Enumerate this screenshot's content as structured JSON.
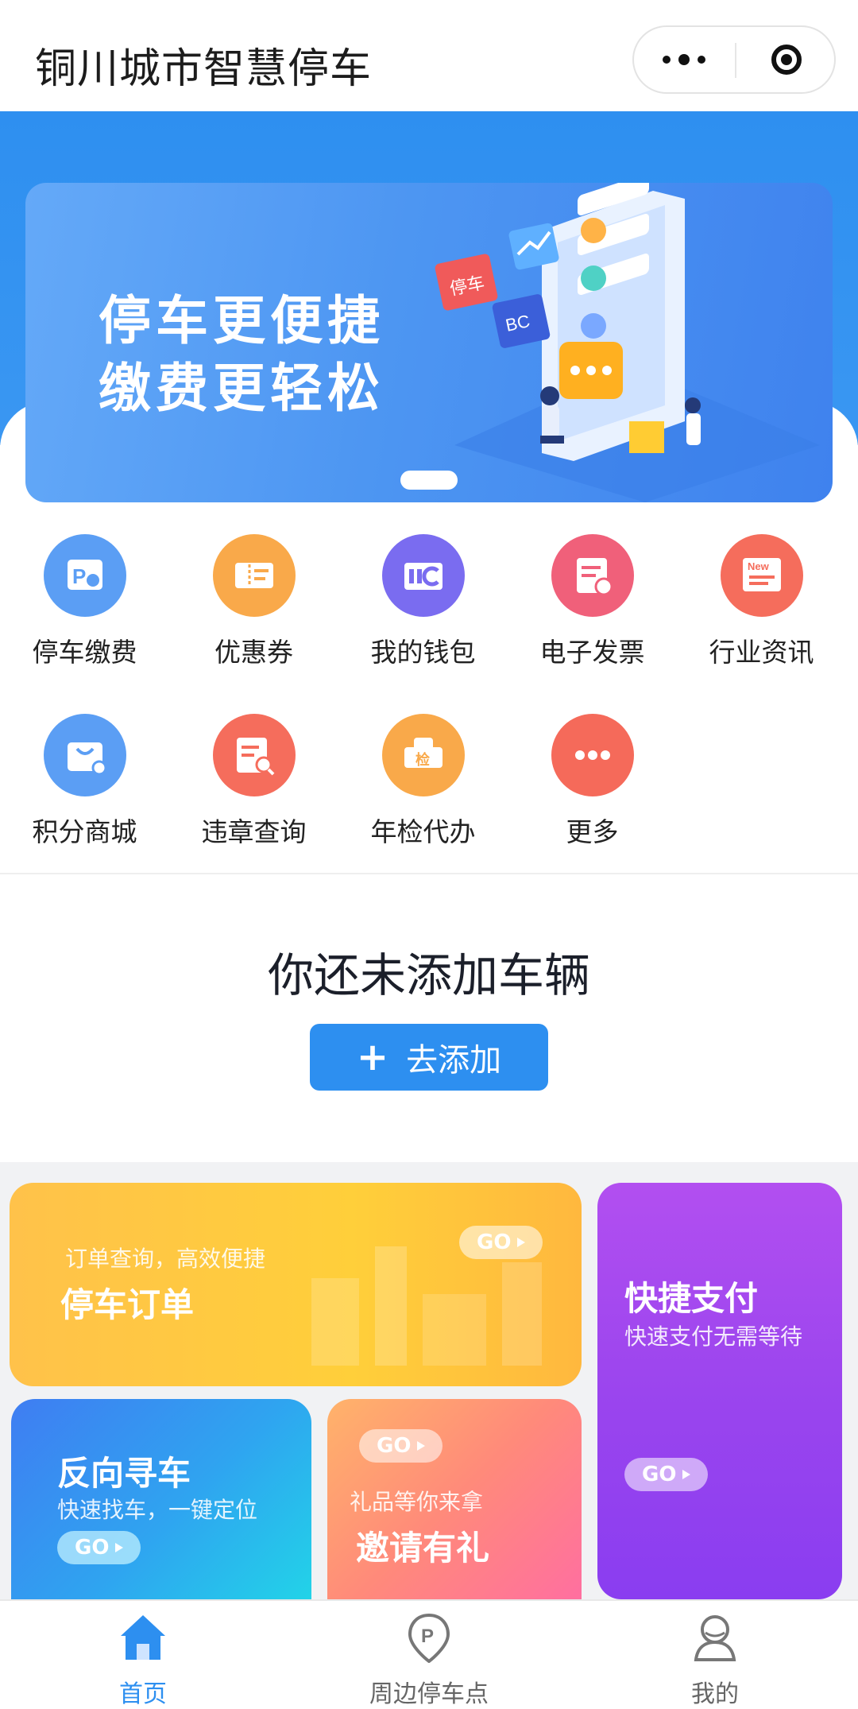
{
  "header": {
    "title": "铜川城市智慧停车"
  },
  "banner": {
    "line1": "停车更便捷",
    "line2": "缴费更轻松",
    "badge1": "停车",
    "badge2": "BC"
  },
  "menu": [
    {
      "label": "停车缴费",
      "icon": "parking-pay-icon",
      "color": "#5b9ef4"
    },
    {
      "label": "优惠券",
      "icon": "coupon-icon",
      "color": "#f9a94a"
    },
    {
      "label": "我的钱包",
      "icon": "wallet-icon",
      "color": "#7a6cf0"
    },
    {
      "label": "电子发票",
      "icon": "invoice-icon",
      "color": "#f0607a"
    },
    {
      "label": "行业资讯",
      "icon": "news-icon",
      "color": "#f56d5c",
      "badge": "New"
    },
    {
      "label": "积分商城",
      "icon": "shopping-bag-icon",
      "color": "#5b9ef4"
    },
    {
      "label": "违章查询",
      "icon": "violation-search-icon",
      "color": "#f56d5c"
    },
    {
      "label": "年检代办",
      "icon": "inspection-icon",
      "color": "#f9a94a",
      "badge": "检"
    },
    {
      "label": "更多",
      "icon": "more-icon",
      "color": "#f56a5a"
    }
  ],
  "vehicle": {
    "empty_text": "你还未添加车辆",
    "add_label": "去添加"
  },
  "cards": {
    "order": {
      "subtitle": "订单查询，高效便捷",
      "title": "停车订单",
      "go": "GO"
    },
    "pay": {
      "title": "快捷支付",
      "subtitle": "快速支付无需等待",
      "go": "GO"
    },
    "find": {
      "title": "反向寻车",
      "subtitle": "快速找车，一键定位",
      "go": "GO"
    },
    "invite": {
      "subtitle": "礼品等你来拿",
      "title": "邀请有礼",
      "go": "GO"
    }
  },
  "tabbar": [
    {
      "label": "首页",
      "icon": "home-icon",
      "active": true
    },
    {
      "label": "周边停车点",
      "icon": "parking-location-icon",
      "active": false
    },
    {
      "label": "我的",
      "icon": "user-icon",
      "active": false
    }
  ]
}
